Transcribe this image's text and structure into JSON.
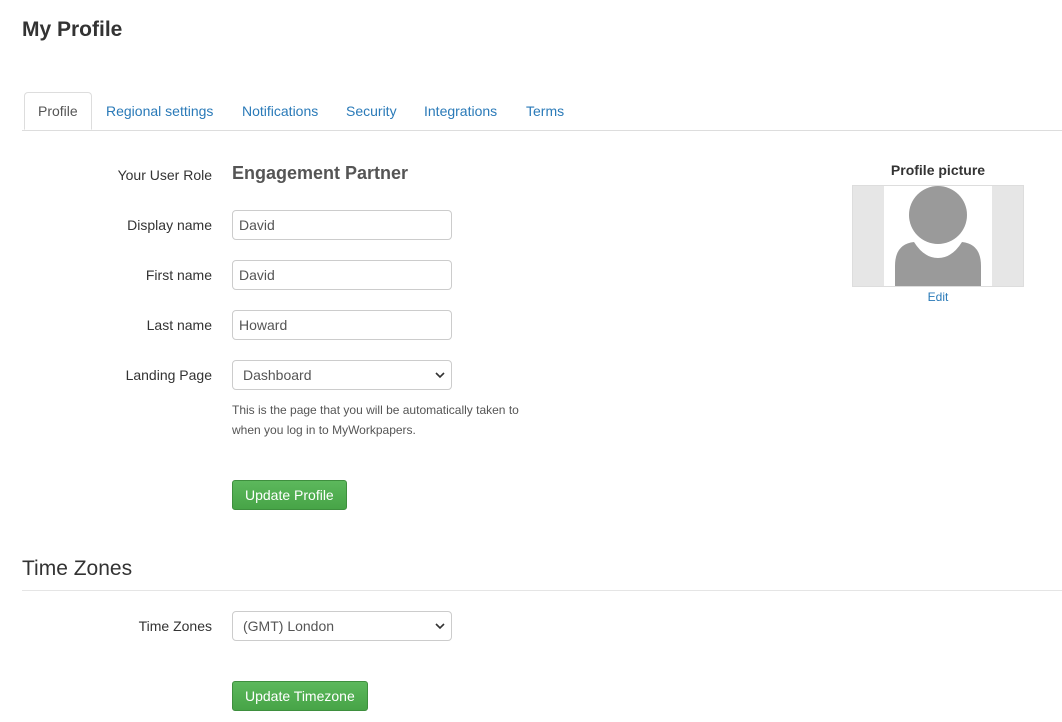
{
  "page": {
    "title": "My Profile"
  },
  "tabs": [
    {
      "label": "Profile",
      "active": true
    },
    {
      "label": "Regional settings"
    },
    {
      "label": "Notifications"
    },
    {
      "label": "Security"
    },
    {
      "label": "Integrations"
    },
    {
      "label": "Terms"
    }
  ],
  "profile": {
    "role_label": "Your User Role",
    "role_value": "Engagement Partner",
    "display_name": {
      "label": "Display name",
      "value": "David"
    },
    "first_name": {
      "label": "First name",
      "value": "David"
    },
    "last_name": {
      "label": "Last name",
      "value": "Howard"
    },
    "landing_page": {
      "label": "Landing Page",
      "selected": "Dashboard",
      "help_line1": "This is the page that you will be automatically taken to",
      "help_line2": "when you log in to MyWorkpapers."
    },
    "update_button": "Update Profile"
  },
  "picture": {
    "title": "Profile picture",
    "edit_label": "Edit",
    "icon": "avatar-placeholder-icon"
  },
  "timezones": {
    "section_title": "Time Zones",
    "label": "Time Zones",
    "selected": "(GMT) London",
    "update_button": "Update Timezone"
  },
  "colors": {
    "link": "#2a7ab8",
    "button_green": "#5cb85c",
    "text": "#333333"
  }
}
